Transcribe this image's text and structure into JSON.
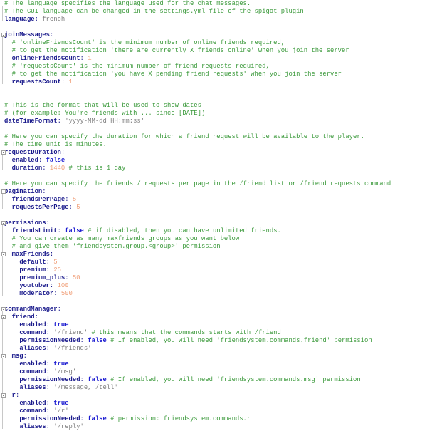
{
  "lines": [
    [
      {
        "t": "c",
        "v": "# The language specifies the language used for the chat messages."
      }
    ],
    [
      {
        "t": "c",
        "v": "# The GUI language can be changed in the settings.yml file of the spigot plugin"
      }
    ],
    [
      {
        "t": "k",
        "v": "language"
      },
      {
        "t": "p",
        "v": ": "
      },
      {
        "t": "s",
        "v": "french"
      }
    ],
    [],
    [
      {
        "t": "k",
        "v": "joinMessages"
      },
      {
        "t": "p",
        "v": ":"
      }
    ],
    [
      {
        "t": "s",
        "v": "  "
      },
      {
        "t": "c",
        "v": "# 'onlineFriendsCount' is the minimum number of online friends required,"
      }
    ],
    [
      {
        "t": "s",
        "v": "  "
      },
      {
        "t": "c",
        "v": "# to get the notification 'there are currently X friends online' when you join the server"
      }
    ],
    [
      {
        "t": "s",
        "v": "  "
      },
      {
        "t": "k",
        "v": "onlineFriendsCount"
      },
      {
        "t": "p",
        "v": ": "
      },
      {
        "t": "n",
        "v": "1"
      }
    ],
    [
      {
        "t": "s",
        "v": "  "
      },
      {
        "t": "c",
        "v": "# 'requestsCount' is the minimum number of friend requests required,"
      }
    ],
    [
      {
        "t": "s",
        "v": "  "
      },
      {
        "t": "c",
        "v": "# to get the notification 'you have X pending friend requests' when you join the server"
      }
    ],
    [
      {
        "t": "s",
        "v": "  "
      },
      {
        "t": "k",
        "v": "requestsCount"
      },
      {
        "t": "p",
        "v": ": "
      },
      {
        "t": "n",
        "v": "1"
      }
    ],
    [],
    [],
    [
      {
        "t": "c",
        "v": "# This is the format that will be used to show dates"
      }
    ],
    [
      {
        "t": "c",
        "v": "# (for example: You're friends with ... since [DATE])"
      }
    ],
    [
      {
        "t": "k",
        "v": "dateTimeFormat"
      },
      {
        "t": "p",
        "v": ": "
      },
      {
        "t": "s",
        "v": "'yyyy-MM-dd HH:mm:ss'"
      }
    ],
    [],
    [
      {
        "t": "c",
        "v": "# Here you can specify the duration for which a friend request will be available to the player."
      }
    ],
    [
      {
        "t": "c",
        "v": "# The time unit is minutes."
      }
    ],
    [
      {
        "t": "k",
        "v": "requestDuration"
      },
      {
        "t": "p",
        "v": ":"
      }
    ],
    [
      {
        "t": "s",
        "v": "  "
      },
      {
        "t": "k",
        "v": "enabled"
      },
      {
        "t": "p",
        "v": ": "
      },
      {
        "t": "b",
        "v": "false"
      }
    ],
    [
      {
        "t": "s",
        "v": "  "
      },
      {
        "t": "k",
        "v": "duration"
      },
      {
        "t": "p",
        "v": ": "
      },
      {
        "t": "n",
        "v": "1440"
      },
      {
        "t": "c",
        "v": " # this is 1 day"
      }
    ],
    [],
    [
      {
        "t": "c",
        "v": "# Here you can specify the friends / requests per page in the /friend list or /friend requests command"
      }
    ],
    [
      {
        "t": "k",
        "v": "pagination"
      },
      {
        "t": "p",
        "v": ":"
      }
    ],
    [
      {
        "t": "s",
        "v": "  "
      },
      {
        "t": "k",
        "v": "friendsPerPage"
      },
      {
        "t": "p",
        "v": ": "
      },
      {
        "t": "n",
        "v": "5"
      }
    ],
    [
      {
        "t": "s",
        "v": "  "
      },
      {
        "t": "k",
        "v": "requestsPerPage"
      },
      {
        "t": "p",
        "v": ": "
      },
      {
        "t": "n",
        "v": "5"
      }
    ],
    [],
    [
      {
        "t": "k",
        "v": "permissions"
      },
      {
        "t": "p",
        "v": ":"
      }
    ],
    [
      {
        "t": "s",
        "v": "  "
      },
      {
        "t": "k",
        "v": "friendsLimit"
      },
      {
        "t": "p",
        "v": ": "
      },
      {
        "t": "b",
        "v": "false"
      },
      {
        "t": "c",
        "v": " # if disabled, then you can have unlimited friends."
      }
    ],
    [
      {
        "t": "s",
        "v": "  "
      },
      {
        "t": "c",
        "v": "# You can create as many maxfriends groups as you want below"
      }
    ],
    [
      {
        "t": "s",
        "v": "  "
      },
      {
        "t": "c",
        "v": "# and give them 'friendsystem.group.<group>' permission"
      }
    ],
    [
      {
        "t": "s",
        "v": "  "
      },
      {
        "t": "k",
        "v": "maxFriends"
      },
      {
        "t": "p",
        "v": ":"
      }
    ],
    [
      {
        "t": "s",
        "v": "    "
      },
      {
        "t": "k",
        "v": "default"
      },
      {
        "t": "p",
        "v": ": "
      },
      {
        "t": "n",
        "v": "5"
      }
    ],
    [
      {
        "t": "s",
        "v": "    "
      },
      {
        "t": "k",
        "v": "premium"
      },
      {
        "t": "p",
        "v": ": "
      },
      {
        "t": "n",
        "v": "25"
      }
    ],
    [
      {
        "t": "s",
        "v": "    "
      },
      {
        "t": "k",
        "v": "premium_plus"
      },
      {
        "t": "p",
        "v": ": "
      },
      {
        "t": "n",
        "v": "50"
      }
    ],
    [
      {
        "t": "s",
        "v": "    "
      },
      {
        "t": "k",
        "v": "youtuber"
      },
      {
        "t": "p",
        "v": ": "
      },
      {
        "t": "n",
        "v": "100"
      }
    ],
    [
      {
        "t": "s",
        "v": "    "
      },
      {
        "t": "k",
        "v": "moderator"
      },
      {
        "t": "p",
        "v": ": "
      },
      {
        "t": "n",
        "v": "500"
      }
    ],
    [],
    [
      {
        "t": "k",
        "v": "commandManager"
      },
      {
        "t": "p",
        "v": ":"
      }
    ],
    [
      {
        "t": "s",
        "v": "  "
      },
      {
        "t": "k",
        "v": "friend"
      },
      {
        "t": "p",
        "v": ":"
      }
    ],
    [
      {
        "t": "s",
        "v": "    "
      },
      {
        "t": "k",
        "v": "enabled"
      },
      {
        "t": "p",
        "v": ": "
      },
      {
        "t": "b",
        "v": "true"
      }
    ],
    [
      {
        "t": "s",
        "v": "    "
      },
      {
        "t": "k",
        "v": "command"
      },
      {
        "t": "p",
        "v": ": "
      },
      {
        "t": "s",
        "v": "'/friend'"
      },
      {
        "t": "c",
        "v": " # this means that the commands starts with /friend"
      }
    ],
    [
      {
        "t": "s",
        "v": "    "
      },
      {
        "t": "k",
        "v": "permissionNeeded"
      },
      {
        "t": "p",
        "v": ": "
      },
      {
        "t": "b",
        "v": "false"
      },
      {
        "t": "c",
        "v": " # If enabled, you will need 'friendsystem.commands.friend' permission"
      }
    ],
    [
      {
        "t": "s",
        "v": "    "
      },
      {
        "t": "k",
        "v": "aliases"
      },
      {
        "t": "p",
        "v": ": "
      },
      {
        "t": "s",
        "v": "'/friends'"
      }
    ],
    [
      {
        "t": "s",
        "v": "  "
      },
      {
        "t": "k",
        "v": "msg"
      },
      {
        "t": "p",
        "v": ":"
      }
    ],
    [
      {
        "t": "s",
        "v": "    "
      },
      {
        "t": "k",
        "v": "enabled"
      },
      {
        "t": "p",
        "v": ": "
      },
      {
        "t": "b",
        "v": "true"
      }
    ],
    [
      {
        "t": "s",
        "v": "    "
      },
      {
        "t": "k",
        "v": "command"
      },
      {
        "t": "p",
        "v": ": "
      },
      {
        "t": "s",
        "v": "'/msg'"
      }
    ],
    [
      {
        "t": "s",
        "v": "    "
      },
      {
        "t": "k",
        "v": "permissionNeeded"
      },
      {
        "t": "p",
        "v": ": "
      },
      {
        "t": "b",
        "v": "false"
      },
      {
        "t": "c",
        "v": " # If enabled, you will need 'friendsystem.commands.msg' permission"
      }
    ],
    [
      {
        "t": "s",
        "v": "    "
      },
      {
        "t": "k",
        "v": "aliases"
      },
      {
        "t": "p",
        "v": ": "
      },
      {
        "t": "s",
        "v": "'/message, /tell'"
      }
    ],
    [
      {
        "t": "s",
        "v": "  "
      },
      {
        "t": "k",
        "v": "r"
      },
      {
        "t": "p",
        "v": ":"
      }
    ],
    [
      {
        "t": "s",
        "v": "    "
      },
      {
        "t": "k",
        "v": "enabled"
      },
      {
        "t": "p",
        "v": ": "
      },
      {
        "t": "b",
        "v": "true"
      }
    ],
    [
      {
        "t": "s",
        "v": "    "
      },
      {
        "t": "k",
        "v": "command"
      },
      {
        "t": "p",
        "v": ": "
      },
      {
        "t": "s",
        "v": "'/r'"
      }
    ],
    [
      {
        "t": "s",
        "v": "    "
      },
      {
        "t": "k",
        "v": "permissionNeeded"
      },
      {
        "t": "p",
        "v": ": "
      },
      {
        "t": "b",
        "v": "false"
      },
      {
        "t": "c",
        "v": " # permission: friendsystem.commands.r"
      }
    ],
    [
      {
        "t": "s",
        "v": "    "
      },
      {
        "t": "k",
        "v": "aliases"
      },
      {
        "t": "p",
        "v": ": "
      },
      {
        "t": "s",
        "v": "'/reply'"
      }
    ]
  ],
  "folds": [
    4,
    19,
    24,
    28,
    32,
    39,
    40,
    45,
    50
  ]
}
